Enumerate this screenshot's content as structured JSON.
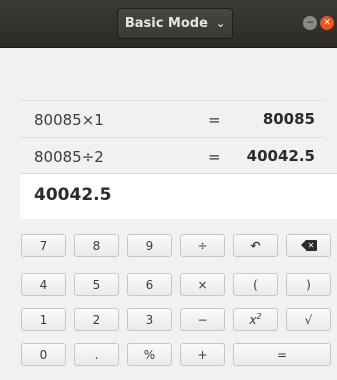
{
  "window": {
    "mode_label": "Basic Mode",
    "mode_chevron_icon": "chevron-down-icon",
    "minimize_icon": "minimize-icon",
    "close_icon": "close-icon"
  },
  "history": [
    {
      "expression": "80085×1",
      "equals": "=",
      "result": "80085"
    },
    {
      "expression": "80085÷2",
      "equals": "=",
      "result": "40042.5"
    }
  ],
  "display": {
    "value": "40042.5"
  },
  "keypad": {
    "row1": [
      "7",
      "8",
      "9",
      "÷",
      "↶",
      "backspace"
    ],
    "row2": [
      "4",
      "5",
      "6",
      "×",
      "(",
      ")"
    ],
    "row3": [
      "1",
      "2",
      "3",
      "−",
      "x2",
      "√"
    ],
    "row4": [
      "0",
      ".",
      "%",
      "+",
      "="
    ],
    "undo_icon": "undo-icon",
    "backspace_icon": "backspace-icon"
  }
}
